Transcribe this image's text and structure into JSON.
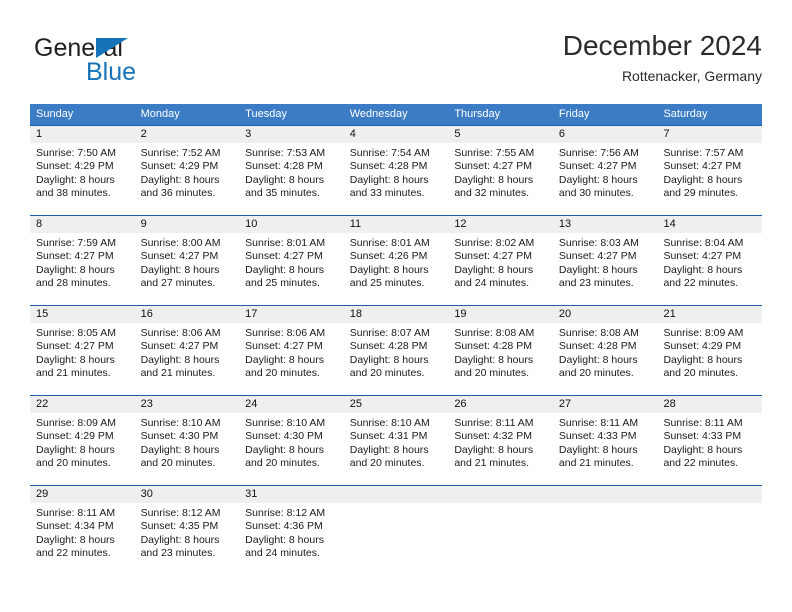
{
  "branding": {
    "logo_text_primary": "General",
    "logo_text_secondary": "Blue",
    "logo_accent_color": "#1673b8"
  },
  "header": {
    "title": "December 2024",
    "location": "Rottenacker, Germany"
  },
  "colors": {
    "header_row_background": "#3b7cc4",
    "week_separator": "#1f5fa9",
    "daynumber_band": "#efefef",
    "text": "#1a1a1a"
  },
  "weekdays": [
    "Sunday",
    "Monday",
    "Tuesday",
    "Wednesday",
    "Thursday",
    "Friday",
    "Saturday"
  ],
  "weeks": [
    {
      "days": [
        {
          "number": "1",
          "sunrise": "Sunrise: 7:50 AM",
          "sunset": "Sunset: 4:29 PM",
          "daylight": "Daylight: 8 hours and 38 minutes."
        },
        {
          "number": "2",
          "sunrise": "Sunrise: 7:52 AM",
          "sunset": "Sunset: 4:29 PM",
          "daylight": "Daylight: 8 hours and 36 minutes."
        },
        {
          "number": "3",
          "sunrise": "Sunrise: 7:53 AM",
          "sunset": "Sunset: 4:28 PM",
          "daylight": "Daylight: 8 hours and 35 minutes."
        },
        {
          "number": "4",
          "sunrise": "Sunrise: 7:54 AM",
          "sunset": "Sunset: 4:28 PM",
          "daylight": "Daylight: 8 hours and 33 minutes."
        },
        {
          "number": "5",
          "sunrise": "Sunrise: 7:55 AM",
          "sunset": "Sunset: 4:27 PM",
          "daylight": "Daylight: 8 hours and 32 minutes."
        },
        {
          "number": "6",
          "sunrise": "Sunrise: 7:56 AM",
          "sunset": "Sunset: 4:27 PM",
          "daylight": "Daylight: 8 hours and 30 minutes."
        },
        {
          "number": "7",
          "sunrise": "Sunrise: 7:57 AM",
          "sunset": "Sunset: 4:27 PM",
          "daylight": "Daylight: 8 hours and 29 minutes."
        }
      ]
    },
    {
      "days": [
        {
          "number": "8",
          "sunrise": "Sunrise: 7:59 AM",
          "sunset": "Sunset: 4:27 PM",
          "daylight": "Daylight: 8 hours and 28 minutes."
        },
        {
          "number": "9",
          "sunrise": "Sunrise: 8:00 AM",
          "sunset": "Sunset: 4:27 PM",
          "daylight": "Daylight: 8 hours and 27 minutes."
        },
        {
          "number": "10",
          "sunrise": "Sunrise: 8:01 AM",
          "sunset": "Sunset: 4:27 PM",
          "daylight": "Daylight: 8 hours and 25 minutes."
        },
        {
          "number": "11",
          "sunrise": "Sunrise: 8:01 AM",
          "sunset": "Sunset: 4:26 PM",
          "daylight": "Daylight: 8 hours and 25 minutes."
        },
        {
          "number": "12",
          "sunrise": "Sunrise: 8:02 AM",
          "sunset": "Sunset: 4:27 PM",
          "daylight": "Daylight: 8 hours and 24 minutes."
        },
        {
          "number": "13",
          "sunrise": "Sunrise: 8:03 AM",
          "sunset": "Sunset: 4:27 PM",
          "daylight": "Daylight: 8 hours and 23 minutes."
        },
        {
          "number": "14",
          "sunrise": "Sunrise: 8:04 AM",
          "sunset": "Sunset: 4:27 PM",
          "daylight": "Daylight: 8 hours and 22 minutes."
        }
      ]
    },
    {
      "days": [
        {
          "number": "15",
          "sunrise": "Sunrise: 8:05 AM",
          "sunset": "Sunset: 4:27 PM",
          "daylight": "Daylight: 8 hours and 21 minutes."
        },
        {
          "number": "16",
          "sunrise": "Sunrise: 8:06 AM",
          "sunset": "Sunset: 4:27 PM",
          "daylight": "Daylight: 8 hours and 21 minutes."
        },
        {
          "number": "17",
          "sunrise": "Sunrise: 8:06 AM",
          "sunset": "Sunset: 4:27 PM",
          "daylight": "Daylight: 8 hours and 20 minutes."
        },
        {
          "number": "18",
          "sunrise": "Sunrise: 8:07 AM",
          "sunset": "Sunset: 4:28 PM",
          "daylight": "Daylight: 8 hours and 20 minutes."
        },
        {
          "number": "19",
          "sunrise": "Sunrise: 8:08 AM",
          "sunset": "Sunset: 4:28 PM",
          "daylight": "Daylight: 8 hours and 20 minutes."
        },
        {
          "number": "20",
          "sunrise": "Sunrise: 8:08 AM",
          "sunset": "Sunset: 4:28 PM",
          "daylight": "Daylight: 8 hours and 20 minutes."
        },
        {
          "number": "21",
          "sunrise": "Sunrise: 8:09 AM",
          "sunset": "Sunset: 4:29 PM",
          "daylight": "Daylight: 8 hours and 20 minutes."
        }
      ]
    },
    {
      "days": [
        {
          "number": "22",
          "sunrise": "Sunrise: 8:09 AM",
          "sunset": "Sunset: 4:29 PM",
          "daylight": "Daylight: 8 hours and 20 minutes."
        },
        {
          "number": "23",
          "sunrise": "Sunrise: 8:10 AM",
          "sunset": "Sunset: 4:30 PM",
          "daylight": "Daylight: 8 hours and 20 minutes."
        },
        {
          "number": "24",
          "sunrise": "Sunrise: 8:10 AM",
          "sunset": "Sunset: 4:30 PM",
          "daylight": "Daylight: 8 hours and 20 minutes."
        },
        {
          "number": "25",
          "sunrise": "Sunrise: 8:10 AM",
          "sunset": "Sunset: 4:31 PM",
          "daylight": "Daylight: 8 hours and 20 minutes."
        },
        {
          "number": "26",
          "sunrise": "Sunrise: 8:11 AM",
          "sunset": "Sunset: 4:32 PM",
          "daylight": "Daylight: 8 hours and 21 minutes."
        },
        {
          "number": "27",
          "sunrise": "Sunrise: 8:11 AM",
          "sunset": "Sunset: 4:33 PM",
          "daylight": "Daylight: 8 hours and 21 minutes."
        },
        {
          "number": "28",
          "sunrise": "Sunrise: 8:11 AM",
          "sunset": "Sunset: 4:33 PM",
          "daylight": "Daylight: 8 hours and 22 minutes."
        }
      ]
    },
    {
      "days": [
        {
          "number": "29",
          "sunrise": "Sunrise: 8:11 AM",
          "sunset": "Sunset: 4:34 PM",
          "daylight": "Daylight: 8 hours and 22 minutes."
        },
        {
          "number": "30",
          "sunrise": "Sunrise: 8:12 AM",
          "sunset": "Sunset: 4:35 PM",
          "daylight": "Daylight: 8 hours and 23 minutes."
        },
        {
          "number": "31",
          "sunrise": "Sunrise: 8:12 AM",
          "sunset": "Sunset: 4:36 PM",
          "daylight": "Daylight: 8 hours and 24 minutes."
        },
        {
          "number": "",
          "sunrise": "",
          "sunset": "",
          "daylight": ""
        },
        {
          "number": "",
          "sunrise": "",
          "sunset": "",
          "daylight": ""
        },
        {
          "number": "",
          "sunrise": "",
          "sunset": "",
          "daylight": ""
        },
        {
          "number": "",
          "sunrise": "",
          "sunset": "",
          "daylight": ""
        }
      ]
    }
  ]
}
